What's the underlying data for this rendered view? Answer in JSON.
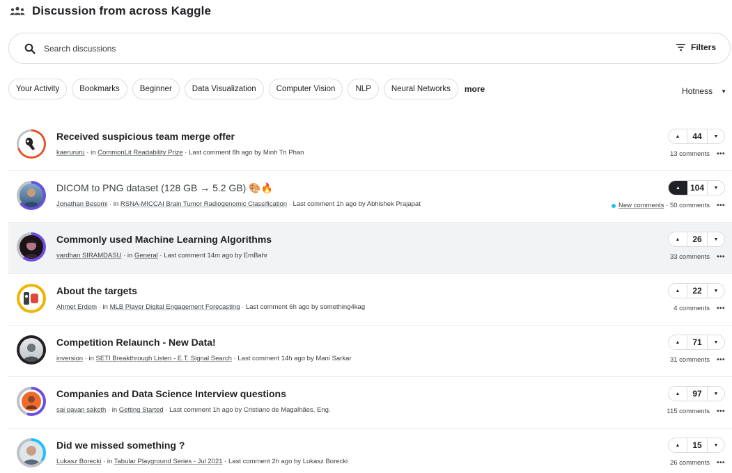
{
  "header": {
    "title": "Discussion from across Kaggle",
    "icon": "people-icon"
  },
  "search": {
    "placeholder": "Search discussions",
    "value": "",
    "filters_label": "Filters"
  },
  "chips": [
    "Your Activity",
    "Bookmarks",
    "Beginner",
    "Data Visualization",
    "Computer Vision",
    "NLP",
    "Neural Networks"
  ],
  "more_label": "more",
  "sort": {
    "label": "Hotness"
  },
  "topics": [
    {
      "title": "Received suspicious team merge offer",
      "author": "kaerururu",
      "in_label": "in",
      "forum": "CommonLit Readability Prize",
      "last_comment_label": "Last comment",
      "time": "8h ago",
      "by_label": "by",
      "last_by": "Minh Tri Phan",
      "votes": "44",
      "comments": "13 comments",
      "upvoted": false,
      "new_comments": ""
    },
    {
      "title": "DICOM to PNG dataset (128 GB → 5.2 GB) 🎨🔥",
      "author": "Jonathan Besomi",
      "in_label": "in",
      "forum": "RSNA-MICCAI Brain Tumor Radiogenomic Classification",
      "last_comment_label": "Last comment",
      "time": "1h ago",
      "by_label": "by",
      "last_by": "Abhishek Prajapat",
      "votes": "104",
      "comments": "50 comments",
      "upvoted": true,
      "new_comments": "New comments"
    },
    {
      "title": "Commonly used Machine Learning Algorithms",
      "author": "vardhan SIRAMDASU",
      "in_label": "in",
      "forum": "General",
      "last_comment_label": "Last comment",
      "time": "14m ago",
      "by_label": "by",
      "last_by": "EmBahr",
      "votes": "26",
      "comments": "33 comments",
      "upvoted": false,
      "new_comments": ""
    },
    {
      "title": "About the targets",
      "author": "Ahmet Erdem",
      "in_label": "in",
      "forum": "MLB Player Digital Engagement Forecasting",
      "last_comment_label": "Last comment",
      "time": "6h ago",
      "by_label": "by",
      "last_by": "something4kag",
      "votes": "22",
      "comments": "4 comments",
      "upvoted": false,
      "new_comments": ""
    },
    {
      "title": "Competition Relaunch - New Data!",
      "author": "inversion",
      "in_label": "in",
      "forum": "SETI Breakthrough Listen - E.T. Signal Search",
      "last_comment_label": "Last comment",
      "time": "14h ago",
      "by_label": "by",
      "last_by": "Mani Sarkar",
      "votes": "71",
      "comments": "31 comments",
      "upvoted": false,
      "new_comments": ""
    },
    {
      "title": "Companies and Data Science Interview questions",
      "author": "sai pavan saketh",
      "in_label": "in",
      "forum": "Getting Started",
      "last_comment_label": "Last comment",
      "time": "1h ago",
      "by_label": "by",
      "last_by": "Cristiano de Magalhães, Eng.",
      "votes": "97",
      "comments": "115 comments",
      "upvoted": false,
      "new_comments": ""
    },
    {
      "title": "Did we missed something ?",
      "author": "Lukasz Borecki",
      "in_label": "in",
      "forum": "Tabular Playground Series - Jul 2021",
      "last_comment_label": "Last comment",
      "time": "2h ago",
      "by_label": "by",
      "last_by": "Lukasz Borecki",
      "votes": "15",
      "comments": "26 comments",
      "upvoted": false,
      "new_comments": ""
    }
  ],
  "colors": {
    "accent": "#20beff",
    "ring_red": "#e8532e",
    "ring_purple": "#6b4fdf",
    "ring_gold": "#f0b400",
    "ring_grey": "#bdc1c6"
  }
}
